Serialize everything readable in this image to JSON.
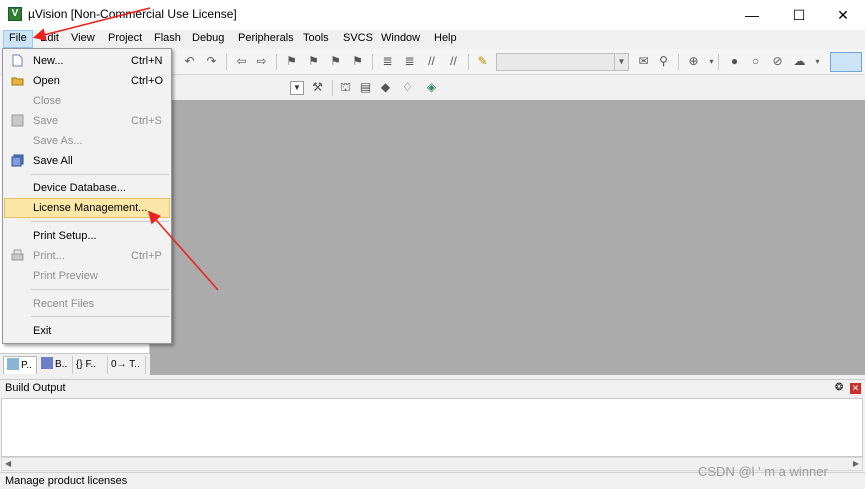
{
  "window": {
    "title": "µVision  [Non-Commercial Use License]",
    "minimize": "—",
    "maximize": "☐",
    "close": "✕"
  },
  "menubar": {
    "items": [
      "File",
      "Edit",
      "View",
      "Project",
      "Flash",
      "Debug",
      "Peripherals",
      "Tools",
      "SVCS",
      "Window",
      "Help"
    ],
    "active": "File"
  },
  "file_menu": {
    "items": [
      {
        "label": "New...",
        "shortcut": "Ctrl+N",
        "enabled": true,
        "icon": "new-file-icon"
      },
      {
        "label": "Open",
        "shortcut": "Ctrl+O",
        "enabled": true,
        "icon": "open-folder-icon"
      },
      {
        "label": "Close",
        "shortcut": "",
        "enabled": false
      },
      {
        "label": "Save",
        "shortcut": "Ctrl+S",
        "enabled": false,
        "icon": "save-icon"
      },
      {
        "label": "Save As...",
        "shortcut": "",
        "enabled": false
      },
      {
        "label": "Save All",
        "shortcut": "",
        "enabled": true,
        "icon": "save-all-icon"
      },
      {
        "label": "Device Database...",
        "shortcut": "",
        "enabled": true
      },
      {
        "label": "License Management...",
        "shortcut": "",
        "enabled": true,
        "highlighted": true
      },
      {
        "label": "Print Setup...",
        "shortcut": "",
        "enabled": true
      },
      {
        "label": "Print...",
        "shortcut": "Ctrl+P",
        "enabled": false,
        "icon": "print-icon"
      },
      {
        "label": "Print Preview",
        "shortcut": "",
        "enabled": false
      },
      {
        "label": "Recent Files",
        "shortcut": "",
        "enabled": false
      },
      {
        "label": "Exit",
        "shortcut": "",
        "enabled": true
      }
    ]
  },
  "project_tabs": [
    {
      "label": "P..",
      "icon": "project-icon",
      "selected": true
    },
    {
      "label": "B..",
      "icon": "books-icon",
      "selected": false
    },
    {
      "label": "{} F..",
      "icon": "functions-icon",
      "selected": false
    },
    {
      "label": "0→ T..",
      "icon": "templates-icon",
      "selected": false
    }
  ],
  "build_output": {
    "title": "Build Output",
    "pin": "❂",
    "close": "✕"
  },
  "status": {
    "text": "Manage product licenses"
  },
  "watermark": "CSDN @l ' m a winner",
  "colors": {
    "menu_highlight": "#fbe7a8",
    "active_menu": "#cce4f7",
    "editor_bg": "#ababab",
    "annotation_arrow": "#e8251e"
  }
}
